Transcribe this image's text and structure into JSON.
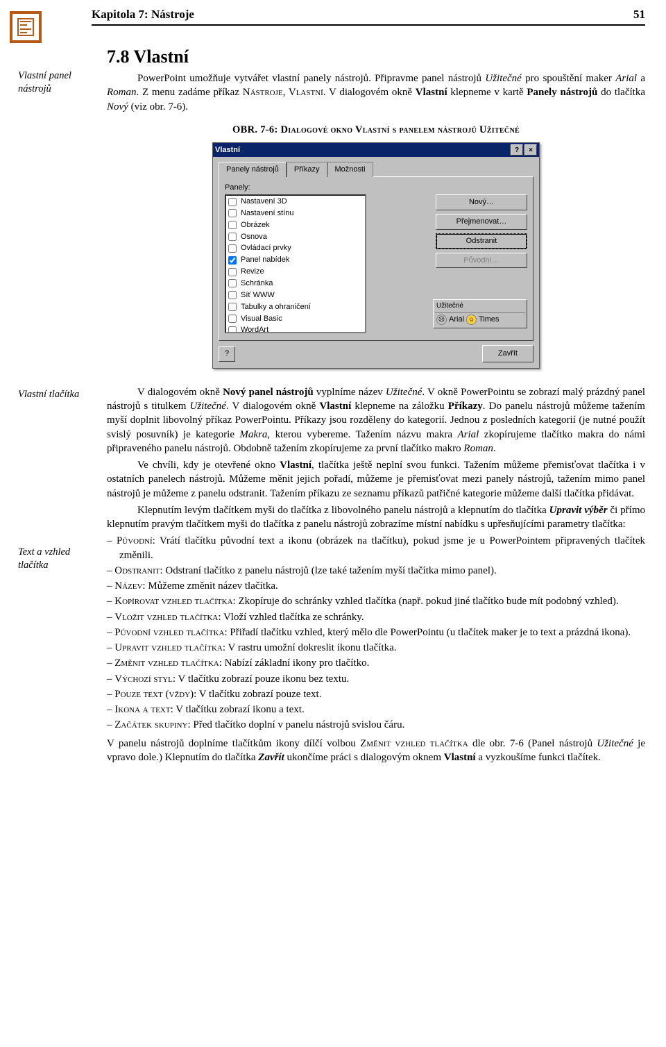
{
  "header": {
    "chapter": "Kapitola 7: Nástroje",
    "page": "51"
  },
  "sectionTitle": "7.8 Vlastní",
  "margin1": "Vlastní panel nástrojů",
  "intro": {
    "p1a": "PowerPoint umožňuje vytvářet vlastní panely nástrojů. Připravme panel nástrojů ",
    "p1b": "Užitečné",
    "p1c": " pro spouštění maker ",
    "p1d": "Arial",
    "p1e": " a ",
    "p1f": "Roman",
    "p1g": ". Z menu zadáme příkaz N",
    "p1h": "ástroje",
    "p1i": ", V",
    "p1j": "lastní",
    "p1k": ". V dialogovém okně ",
    "p1l": "Vlastní",
    "p1m": " klepneme v kartě ",
    "p1n": "Panely nástrojů",
    "p1o": " do tlačítka ",
    "p1p": "Nový",
    "p1q": " (viz obr. 7-6)."
  },
  "figCaption": "OBR. 7-6: Dialogové okno Vlastní s panelem nástrojů Užitečné",
  "dialog": {
    "title": "Vlastní",
    "tabs": [
      "Panely nástrojů",
      "Příkazy",
      "Možnosti"
    ],
    "panelsLabel": "Panely:",
    "items": [
      {
        "label": "Nastavení 3D",
        "checked": false
      },
      {
        "label": "Nastavení stínu",
        "checked": false
      },
      {
        "label": "Obrázek",
        "checked": false
      },
      {
        "label": "Osnova",
        "checked": false
      },
      {
        "label": "Ovládací prvky",
        "checked": false
      },
      {
        "label": "Panel nabídek",
        "checked": true
      },
      {
        "label": "Revize",
        "checked": false
      },
      {
        "label": "Schránka",
        "checked": false
      },
      {
        "label": "Síť WWW",
        "checked": false
      },
      {
        "label": "Tabulky a ohraničení",
        "checked": false
      },
      {
        "label": "Visual Basic",
        "checked": false
      },
      {
        "label": "WordArt",
        "checked": false
      },
      {
        "label": "Užitečné",
        "checked": true
      }
    ],
    "buttons": {
      "new": "Nový…",
      "rename": "Přejmenovat…",
      "delete": "Odstranit",
      "reset": "Původní…"
    },
    "previewTitle": "Užitečné",
    "previewArial": "Arial",
    "previewTimes": "Times",
    "close": "Zavřít"
  },
  "margin2": "Vlastní tlačítka",
  "margin3": "Text a vzhled tlačítka",
  "body2": {
    "p2_1": "V dialogovém okně ",
    "p2_2": "Nový panel nástrojů",
    "p2_3": " vyplníme název ",
    "p2_4": "Užitečné",
    "p2_5": ". V okně PowerPointu se zobrazí malý prázdný panel nástrojů s titulkem ",
    "p2_6": "Užitečné",
    "p2_7": ". V dialogovém okně ",
    "p2_8": "Vlastní",
    "p2_9": " klepneme na záložku ",
    "p2_10": "Příkazy",
    "p2_11": ". Do panelu nástrojů můžeme tažením myší doplnit libovolný příkaz PowerPointu. Příkazy jsou rozděleny do kategorií. Jednou z posledních kategorií (je nutné použít svislý posuvník) je kategorie ",
    "p2_12": "Makra",
    "p2_13": ", kterou vybereme. Tažením názvu makra ",
    "p2_14": "Arial",
    "p2_15": " zkopírujeme tlačítko makra do námi připraveného panelu nástrojů. Obdobně tažením zkopírujeme za první tlačítko makro ",
    "p2_16": "Roman",
    "p2_17": ".",
    "p3_1": "Ve chvíli, kdy je otevřené okno ",
    "p3_2": "Vlastní",
    "p3_3": ", tlačítka ještě neplní svou funkci. Tažením můžeme přemisťovat tlačítka i v ostatních panelech nástrojů. Můžeme měnit jejich pořadí, můžeme je přemisťovat mezi panely nástrojů, tažením mimo panel nástrojů je můžeme z panelu odstranit. Tažením příkazu ze seznamu příkazů patřičné kategorie můžeme další tlačítka přidávat.",
    "p4_1": "Klepnutím levým tlačítkem myši do tlačítka z libovolného panelu nástrojů a klepnutím do tlačítka ",
    "p4_2": "Upravit výběr",
    "p4_3": " či přímo klepnutím pravým tlačítkem myši do tlačítka z panelu nástrojů zobrazíme místní nabídku s upřesňujícími parametry tlačítka:"
  },
  "menu": {
    "m1a": "Původní",
    "m1b": ": Vrátí tlačítku původní text a ikonu (obrázek na tlačítku), pokud jsme je u PowerPointem připravených tlačítek změnili.",
    "m2a": "Odstranit",
    "m2b": ": Odstraní tlačítko z panelu nástrojů (lze také tažením myší tlačítka mimo panel).",
    "m3a": "Název",
    "m3b": ": Můžeme změnit název tlačítka.",
    "m4a": "Kopírovat vzhled tlačítka",
    "m4b": ": Zkopíruje do schránky vzhled tlačítka (např. pokud jiné tlačítko bude mít podobný vzhled).",
    "m5a": "Vložit vzhled tlačítka",
    "m5b": ": Vloží vzhled tlačítka ze schránky.",
    "m6a": "Původní vzhled tlačítka",
    "m6b": ": Přiřadí tlačítku vzhled, který mělo dle PowerPointu (u tlačítek maker je to text a prázdná ikona).",
    "m7a": "Upravit vzhled tlačítka",
    "m7b": ": V rastru umožní dokreslit ikonu tlačítka.",
    "m8a": "Změnit vzhled tlačítka",
    "m8b": ": Nabízí základní ikony pro tlačítko.",
    "m9a": "Výchozí styl",
    "m9b": ": V tlačítku zobrazí pouze ikonu bez textu.",
    "m10a": "Pouze text (vždy)",
    "m10b": ": V tlačítku zobrazí pouze text.",
    "m11a": "Ikona a text",
    "m11b": ": V tlačítku zobrazí ikonu a text.",
    "m12a": "Začátek skupiny",
    "m12b": ": Před tlačítko doplní v panelu nástrojů svislou čáru."
  },
  "tail": {
    "t1": "V panelu nástrojů doplníme tlačítkům ikony dílčí volbou Z",
    "t2": "měnit vzhled tlačítka",
    "t3": " dle obr. 7-6 (Panel nástrojů ",
    "t4": "Užitečné",
    "t5": " je vpravo dole.) Klepnutím do tlačítka ",
    "t6": "Zavřít",
    "t7": " ukončíme práci s dialogovým oknem ",
    "t8": "Vlastní",
    "t9": " a vyzkoušíme funkci tlačítek."
  }
}
